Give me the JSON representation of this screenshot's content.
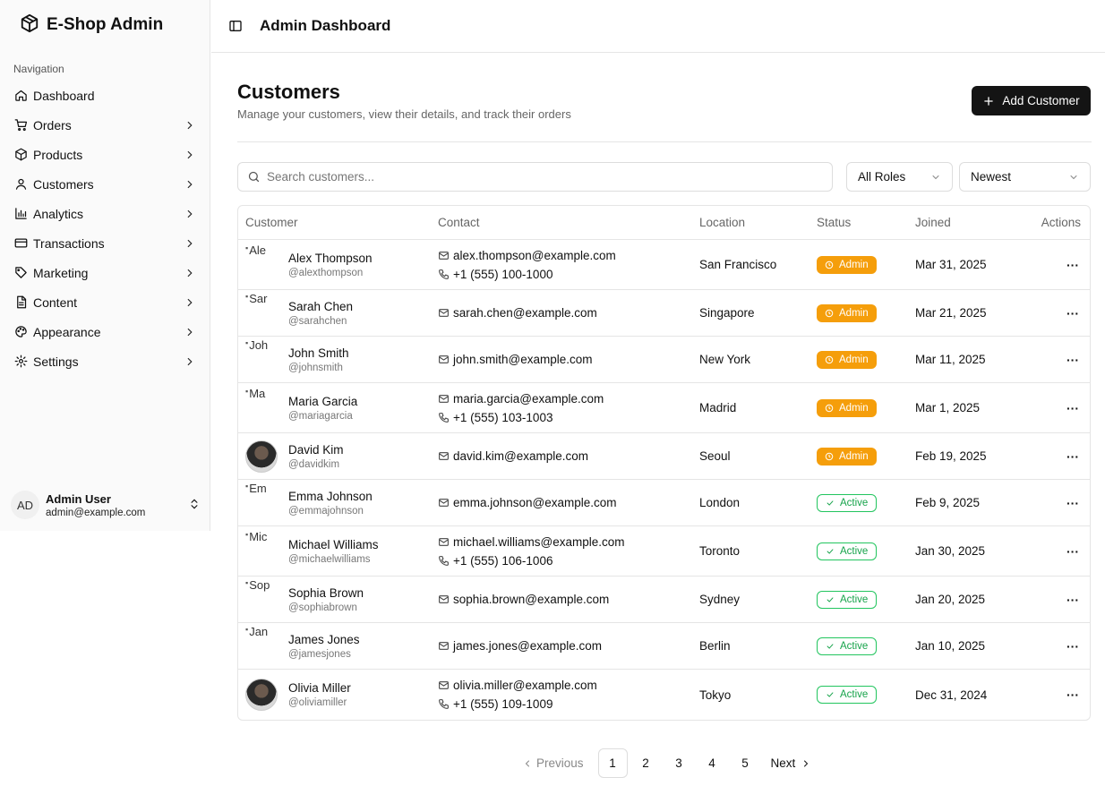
{
  "brand": {
    "title": "E-Shop Admin",
    "icon": "package-icon"
  },
  "sidebar": {
    "heading": "Navigation",
    "items": [
      {
        "label": "Dashboard",
        "icon": "home-icon",
        "has_chevron": false
      },
      {
        "label": "Orders",
        "icon": "cart-icon",
        "has_chevron": true
      },
      {
        "label": "Products",
        "icon": "package-icon",
        "has_chevron": true
      },
      {
        "label": "Customers",
        "icon": "user-icon",
        "has_chevron": true
      },
      {
        "label": "Analytics",
        "icon": "bar-chart-icon",
        "has_chevron": true
      },
      {
        "label": "Transactions",
        "icon": "credit-card-icon",
        "has_chevron": true
      },
      {
        "label": "Marketing",
        "icon": "tag-icon",
        "has_chevron": true
      },
      {
        "label": "Content",
        "icon": "file-text-icon",
        "has_chevron": true
      },
      {
        "label": "Appearance",
        "icon": "palette-icon",
        "has_chevron": true
      },
      {
        "label": "Settings",
        "icon": "gear-icon",
        "has_chevron": true
      }
    ],
    "user": {
      "initials": "AD",
      "name": "Admin User",
      "email": "admin@example.com"
    }
  },
  "header": {
    "title": "Admin Dashboard"
  },
  "page": {
    "title": "Customers",
    "subtitle": "Manage your customers, view their details, and track their orders",
    "add_button": "Add Customer"
  },
  "filters": {
    "search_placeholder": "Search customers...",
    "role": "All Roles",
    "sort": "Newest"
  },
  "table": {
    "columns": [
      "Customer",
      "Contact",
      "Location",
      "Status",
      "Joined",
      "Actions"
    ],
    "rows": [
      {
        "name": "Alex Thompson",
        "handle": "@alexthompson",
        "avatar_alt": "Ale",
        "email": "alex.thompson@example.com",
        "phone": "+1 (555) 100-1000",
        "location": "San Francisco",
        "status": "Admin",
        "joined": "Mar 31, 2025"
      },
      {
        "name": "Sarah Chen",
        "handle": "@sarahchen",
        "avatar_alt": "Sar",
        "email": "sarah.chen@example.com",
        "phone": "",
        "location": "Singapore",
        "status": "Admin",
        "joined": "Mar 21, 2025"
      },
      {
        "name": "John Smith",
        "handle": "@johnsmith",
        "avatar_alt": "Joh",
        "email": "john.smith@example.com",
        "phone": "",
        "location": "New York",
        "status": "Admin",
        "joined": "Mar 11, 2025"
      },
      {
        "name": "Maria Garcia",
        "handle": "@mariagarcia",
        "avatar_alt": "Ma",
        "email": "maria.garcia@example.com",
        "phone": "+1 (555) 103-1003",
        "location": "Madrid",
        "status": "Admin",
        "joined": "Mar 1, 2025"
      },
      {
        "name": "David Kim",
        "handle": "@davidkim",
        "avatar_alt": "",
        "email": "david.kim@example.com",
        "phone": "",
        "location": "Seoul",
        "status": "Admin",
        "joined": "Feb 19, 2025"
      },
      {
        "name": "Emma Johnson",
        "handle": "@emmajohnson",
        "avatar_alt": "Em",
        "email": "emma.johnson@example.com",
        "phone": "",
        "location": "London",
        "status": "Active",
        "joined": "Feb 9, 2025"
      },
      {
        "name": "Michael Williams",
        "handle": "@michaelwilliams",
        "avatar_alt": "Mic",
        "email": "michael.williams@example.com",
        "phone": "+1 (555) 106-1006",
        "location": "Toronto",
        "status": "Active",
        "joined": "Jan 30, 2025"
      },
      {
        "name": "Sophia Brown",
        "handle": "@sophiabrown",
        "avatar_alt": "Sop",
        "email": "sophia.brown@example.com",
        "phone": "",
        "location": "Sydney",
        "status": "Active",
        "joined": "Jan 20, 2025"
      },
      {
        "name": "James Jones",
        "handle": "@jamesjones",
        "avatar_alt": "Jan",
        "email": "james.jones@example.com",
        "phone": "",
        "location": "Berlin",
        "status": "Active",
        "joined": "Jan 10, 2025"
      },
      {
        "name": "Olivia Miller",
        "handle": "@oliviamiller",
        "avatar_alt": "",
        "email": "olivia.miller@example.com",
        "phone": "+1 (555) 109-1009",
        "location": "Tokyo",
        "status": "Active",
        "joined": "Dec 31, 2024"
      }
    ]
  },
  "pagination": {
    "previous": "Previous",
    "next": "Next",
    "pages": [
      "1",
      "2",
      "3",
      "4",
      "5"
    ],
    "current": "1"
  },
  "colors": {
    "admin_badge": "#f59e0b",
    "active_badge": "#22c55e",
    "primary_button": "#141414"
  }
}
